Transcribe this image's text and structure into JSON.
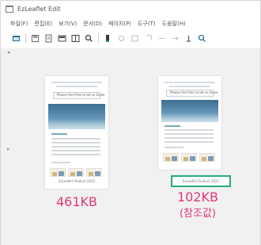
{
  "window": {
    "title": "EzLeaflet Edit"
  },
  "menu": {
    "items": [
      "파일(F)",
      "편집(E)",
      "보기(V)",
      "문서(D)",
      "페이지(P)",
      "도구(T)",
      "도움말(H)"
    ]
  },
  "toolbar": {
    "icons": [
      "open-icon",
      "save-icon",
      "print-icon",
      "image-icon",
      "page-icon",
      "zoom-icon",
      "marker-icon",
      "hand-icon",
      "select-icon",
      "undo-icon",
      "redo-icon",
      "rotate-icon",
      "text-icon",
      "search-icon"
    ]
  },
  "pages": [
    {
      "heading": "Please feel free to let us know",
      "caption": "EzLeaflet Product 2022",
      "size": "461KB"
    },
    {
      "heading": "Please feel free to let us know",
      "caption": "EzLeaflet Product 2022",
      "size": "102KB",
      "note": "(참조값)"
    }
  ],
  "colors": {
    "accent": "#e0377c",
    "highlight": "#2aa884"
  }
}
